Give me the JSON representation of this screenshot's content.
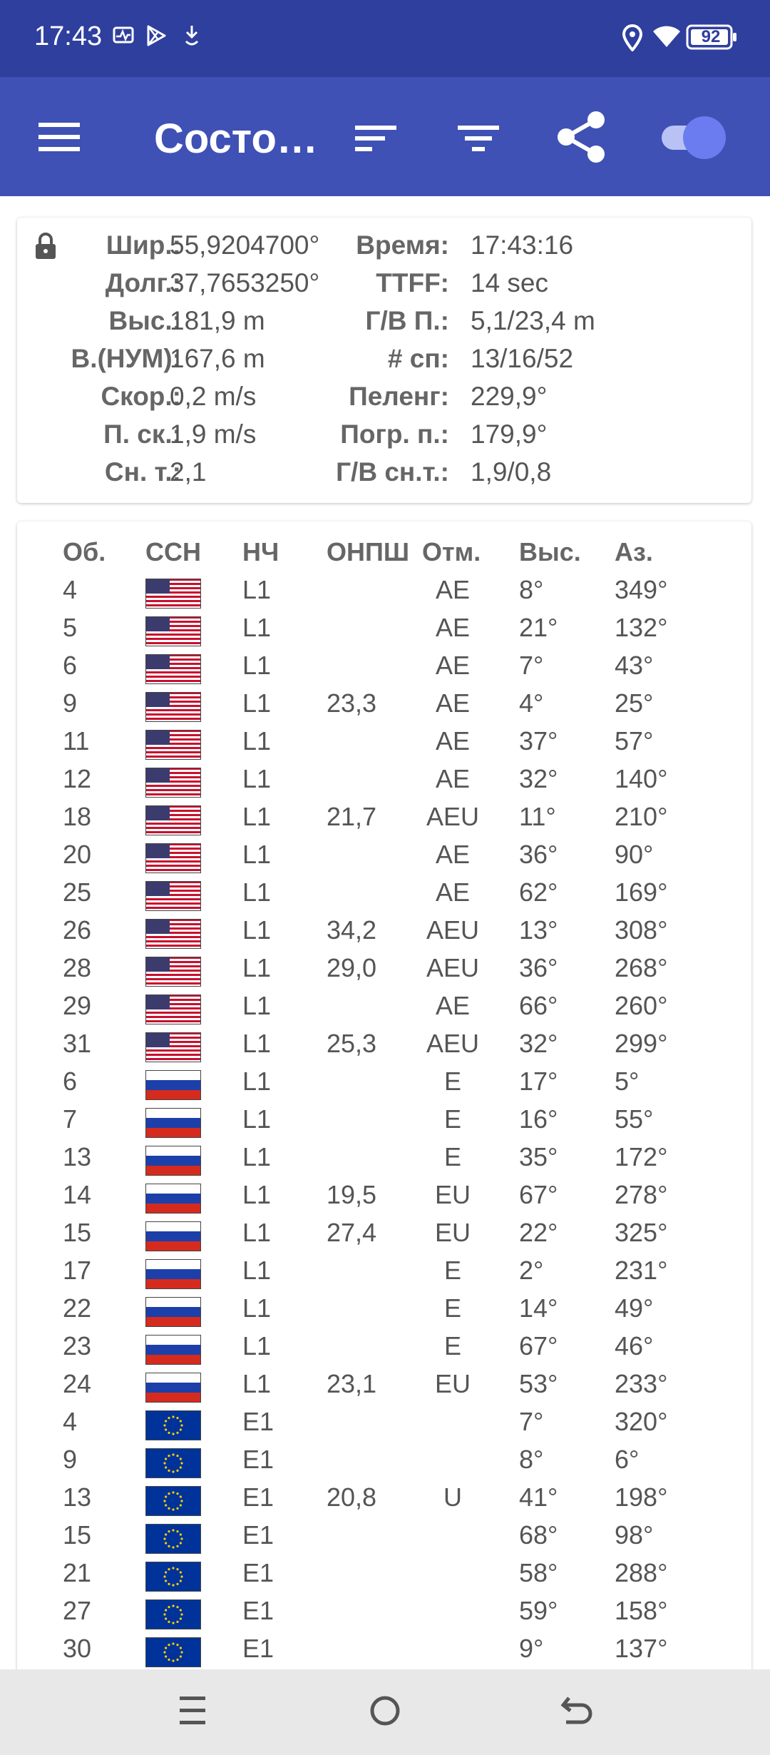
{
  "status_bar": {
    "time": "17:43",
    "battery": "92",
    "icons": [
      "activity-icon",
      "play-store-icon",
      "download-icon",
      "location-icon",
      "wifi-icon",
      "battery-icon"
    ]
  },
  "app_bar": {
    "title": "Состо…",
    "icons": [
      "menu-icon",
      "sort-icon",
      "filter-icon",
      "share-icon",
      "toggle-switch"
    ]
  },
  "info": {
    "rows": [
      {
        "label1": "Шир.:",
        "value1": "55,9204700°",
        "label2": "Время:",
        "value2": "17:43:16"
      },
      {
        "label1": "Долг.:",
        "value1": "37,7653250°",
        "label2": "TTFF:",
        "value2": "14 sec"
      },
      {
        "label1": "Выс.:",
        "value1": "181,9 m",
        "label2": "Г/В П.:",
        "value2": "5,1/23,4 m"
      },
      {
        "label1": "В.(НУМ):",
        "value1": "167,6 m",
        "label2": "# сп:",
        "value2": "13/16/52"
      },
      {
        "label1": "Скор.:",
        "value1": "0,2 m/s",
        "label2": "Пеленг:",
        "value2": "229,9°"
      },
      {
        "label1": "П. ск.:",
        "value1": "1,9 m/s",
        "label2": "Погр. п.:",
        "value2": "179,9°"
      },
      {
        "label1": "Сн. т.:",
        "value1": "2,1",
        "label2": "Г/В сн.т.:",
        "value2": "1,9/0,8"
      }
    ]
  },
  "table": {
    "headers": {
      "prn": "Об.",
      "gnss": "ССН",
      "freq": "НЧ",
      "snr": "ОНПШ",
      "flags": "Отм.",
      "elev": "Выс.",
      "azim": "Аз."
    },
    "rows": [
      {
        "prn": "4",
        "flag": "us-flag-icon",
        "freq": "L1",
        "snr": "",
        "flags": "AE",
        "elev": "8°",
        "azim": "349°"
      },
      {
        "prn": "5",
        "flag": "us-flag-icon",
        "freq": "L1",
        "snr": "",
        "flags": "AE",
        "elev": "21°",
        "azim": "132°"
      },
      {
        "prn": "6",
        "flag": "us-flag-icon",
        "freq": "L1",
        "snr": "",
        "flags": "AE",
        "elev": "7°",
        "azim": "43°"
      },
      {
        "prn": "9",
        "flag": "us-flag-icon",
        "freq": "L1",
        "snr": "23,3",
        "flags": "AE",
        "elev": "4°",
        "azim": "25°"
      },
      {
        "prn": "11",
        "flag": "us-flag-icon",
        "freq": "L1",
        "snr": "",
        "flags": "AE",
        "elev": "37°",
        "azim": "57°"
      },
      {
        "prn": "12",
        "flag": "us-flag-icon",
        "freq": "L1",
        "snr": "",
        "flags": "AE",
        "elev": "32°",
        "azim": "140°"
      },
      {
        "prn": "18",
        "flag": "us-flag-icon",
        "freq": "L1",
        "snr": "21,7",
        "flags": "AEU",
        "elev": "11°",
        "azim": "210°"
      },
      {
        "prn": "20",
        "flag": "us-flag-icon",
        "freq": "L1",
        "snr": "",
        "flags": "AE",
        "elev": "36°",
        "azim": "90°"
      },
      {
        "prn": "25",
        "flag": "us-flag-icon",
        "freq": "L1",
        "snr": "",
        "flags": "AE",
        "elev": "62°",
        "azim": "169°"
      },
      {
        "prn": "26",
        "flag": "us-flag-icon",
        "freq": "L1",
        "snr": "34,2",
        "flags": "AEU",
        "elev": "13°",
        "azim": "308°"
      },
      {
        "prn": "28",
        "flag": "us-flag-icon",
        "freq": "L1",
        "snr": "29,0",
        "flags": "AEU",
        "elev": "36°",
        "azim": "268°"
      },
      {
        "prn": "29",
        "flag": "us-flag-icon",
        "freq": "L1",
        "snr": "",
        "flags": "AE",
        "elev": "66°",
        "azim": "260°"
      },
      {
        "prn": "31",
        "flag": "us-flag-icon",
        "freq": "L1",
        "snr": "25,3",
        "flags": "AEU",
        "elev": "32°",
        "azim": "299°"
      },
      {
        "prn": "6",
        "flag": "ru-flag-icon",
        "freq": "L1",
        "snr": "",
        "flags": "E",
        "elev": "17°",
        "azim": "5°"
      },
      {
        "prn": "7",
        "flag": "ru-flag-icon",
        "freq": "L1",
        "snr": "",
        "flags": "E",
        "elev": "16°",
        "azim": "55°"
      },
      {
        "prn": "13",
        "flag": "ru-flag-icon",
        "freq": "L1",
        "snr": "",
        "flags": "E",
        "elev": "35°",
        "azim": "172°"
      },
      {
        "prn": "14",
        "flag": "ru-flag-icon",
        "freq": "L1",
        "snr": "19,5",
        "flags": "EU",
        "elev": "67°",
        "azim": "278°"
      },
      {
        "prn": "15",
        "flag": "ru-flag-icon",
        "freq": "L1",
        "snr": "27,4",
        "flags": "EU",
        "elev": "22°",
        "azim": "325°"
      },
      {
        "prn": "17",
        "flag": "ru-flag-icon",
        "freq": "L1",
        "snr": "",
        "flags": "E",
        "elev": "2°",
        "azim": "231°"
      },
      {
        "prn": "22",
        "flag": "ru-flag-icon",
        "freq": "L1",
        "snr": "",
        "flags": "E",
        "elev": "14°",
        "azim": "49°"
      },
      {
        "prn": "23",
        "flag": "ru-flag-icon",
        "freq": "L1",
        "snr": "",
        "flags": "E",
        "elev": "67°",
        "azim": "46°"
      },
      {
        "prn": "24",
        "flag": "ru-flag-icon",
        "freq": "L1",
        "snr": "23,1",
        "flags": "EU",
        "elev": "53°",
        "azim": "233°"
      },
      {
        "prn": "4",
        "flag": "eu-flag-icon",
        "freq": "E1",
        "snr": "",
        "flags": "",
        "elev": "7°",
        "azim": "320°"
      },
      {
        "prn": "9",
        "flag": "eu-flag-icon",
        "freq": "E1",
        "snr": "",
        "flags": "",
        "elev": "8°",
        "azim": "6°"
      },
      {
        "prn": "13",
        "flag": "eu-flag-icon",
        "freq": "E1",
        "snr": "20,8",
        "flags": "U",
        "elev": "41°",
        "azim": "198°"
      },
      {
        "prn": "15",
        "flag": "eu-flag-icon",
        "freq": "E1",
        "snr": "",
        "flags": "",
        "elev": "68°",
        "azim": "98°"
      },
      {
        "prn": "21",
        "flag": "eu-flag-icon",
        "freq": "E1",
        "snr": "",
        "flags": "",
        "elev": "58°",
        "azim": "288°"
      },
      {
        "prn": "27",
        "flag": "eu-flag-icon",
        "freq": "E1",
        "snr": "",
        "flags": "",
        "elev": "59°",
        "azim": "158°"
      },
      {
        "prn": "30",
        "flag": "eu-flag-icon",
        "freq": "E1",
        "snr": "",
        "flags": "",
        "elev": "9°",
        "azim": "137°"
      }
    ]
  },
  "nav_bar": {
    "icons": [
      "recents-icon",
      "home-icon",
      "back-icon"
    ]
  },
  "colors": {
    "status_bar": "#2f3f9e",
    "app_bar": "#3f51b5",
    "toggle_thumb": "#6a7cf0",
    "toggle_track": "#b9c2f4"
  }
}
